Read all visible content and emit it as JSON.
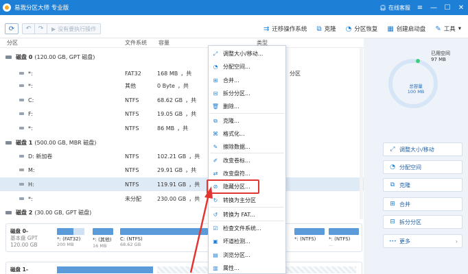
{
  "titlebar": {
    "title": "易我分区大师 专业版",
    "service": "在线客服",
    "min": "—",
    "max": "☐",
    "close": "✕"
  },
  "toolbar": {
    "pending": "没有要执行操作",
    "migrate": "迁移操作系统",
    "clone": "克隆",
    "recover": "分区恢复",
    "bootdisk": "创建启动盘",
    "tools": "工具"
  },
  "columns": {
    "partition": "分区",
    "fs": "文件系统",
    "capacity": "容量",
    "type": "类型"
  },
  "rows": [
    {
      "kind": "disk",
      "name": "磁盘 0",
      "info": "(120.00 GB, GPT 磁盘)"
    },
    {
      "kind": "part",
      "name": "*:",
      "fs": "FAT32",
      "cap": "168 MB",
      "type": "分区"
    },
    {
      "kind": "part",
      "name": "*:",
      "fs": "其他",
      "cap": "0 Byte",
      "type": ""
    },
    {
      "kind": "part",
      "name": "C:",
      "fs": "NTFS",
      "cap": "68.62 GB",
      "type": ""
    },
    {
      "kind": "part",
      "name": "F:",
      "fs": "NTFS",
      "cap": "19.05 GB",
      "type": ""
    },
    {
      "kind": "part",
      "name": "*:",
      "fs": "NTFS",
      "cap": "86 MB",
      "type": ""
    },
    {
      "kind": "disk",
      "name": "磁盘 1",
      "info": "(500.00 GB, MBR 磁盘)"
    },
    {
      "kind": "part",
      "name": "D: 新加卷",
      "fs": "NTFS",
      "cap": "102.21 GB",
      "type": ""
    },
    {
      "kind": "part",
      "name": "M:",
      "fs": "NTFS",
      "cap": "29.91 GB",
      "type": ""
    },
    {
      "kind": "part",
      "name": "H:",
      "fs": "NTFS",
      "cap": "119.91 GB",
      "type": ""
    },
    {
      "kind": "part",
      "name": "*:",
      "fs": "未分配",
      "cap": "230.00 GB",
      "type": ""
    },
    {
      "kind": "disk",
      "name": "磁盘 2",
      "info": "(30.00 GB, GPT 磁盘)"
    }
  ],
  "row_trunc": "，共",
  "diskmap": {
    "disk0_name": "磁盘 0-",
    "disk0_type": "基本盘 GPT",
    "disk0_size": "120.00 GB",
    "segments": [
      {
        "t1": "*: (FAT32)",
        "t2": "200 MB"
      },
      {
        "t1": "*: (其他)",
        "t2": "16 MB"
      },
      {
        "t1": "C: (NTFS)",
        "t2": "68.62 GB"
      },
      {
        "t1": "*: (NTFS)",
        "t2": ""
      },
      {
        "t1": "*: (NTFS)",
        "t2": ""
      }
    ],
    "seg_tail": "...",
    "disk1_name": "磁盘 1-",
    "disk1_type": "基本盘 MBR"
  },
  "sidebar": {
    "used_label": "已用空间",
    "used_value": "97 MB",
    "total_label": "总容量",
    "total_value": "100 MB",
    "buttons": [
      {
        "icon": "resize-icon",
        "label": "调整大小/移动"
      },
      {
        "icon": "allocate-icon",
        "label": "分配空间"
      },
      {
        "icon": "clone-icon",
        "label": "克隆"
      },
      {
        "icon": "merge-icon",
        "label": "合并"
      },
      {
        "icon": "split-icon",
        "label": "拆分分区"
      },
      {
        "icon": "more-icon",
        "label": "更多"
      }
    ]
  },
  "menu": {
    "items": [
      "调整大小/移动...",
      "分配空间...",
      "合并...",
      "拆分分区...",
      "删除...",
      "克隆...",
      "格式化...",
      "擦除数据...",
      "改变卷标...",
      "改变盘符...",
      "隐藏分区...",
      "转换为主分区",
      "转换为 FAT...",
      "检查文件系统...",
      "坏道检测...",
      "浏览分区...",
      "属性..."
    ]
  },
  "colors": {
    "accent": "#1e7fd6",
    "highlight": "#e2352f",
    "used": "#3ccf7a"
  }
}
